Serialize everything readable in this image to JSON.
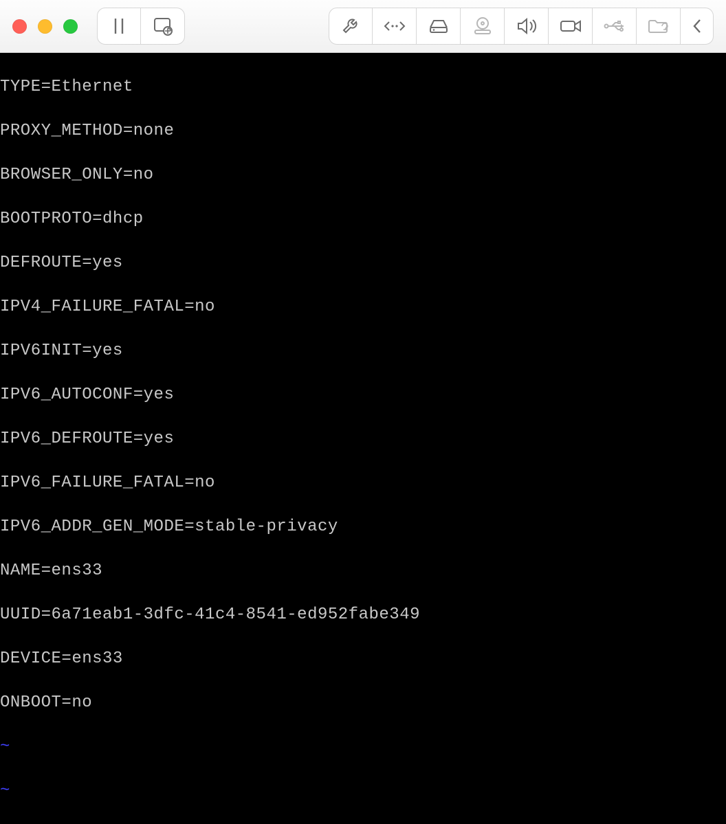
{
  "window": {
    "traffic_lights": [
      "close",
      "minimize",
      "zoom"
    ]
  },
  "toolbar": {
    "left_group": [
      {
        "name": "pause-button",
        "icon": "pause-icon"
      },
      {
        "name": "snapshot-button",
        "icon": "snapshot-icon"
      }
    ],
    "right_group": [
      {
        "name": "settings-button",
        "icon": "wrench-icon"
      },
      {
        "name": "fit-button",
        "icon": "resize-icon"
      },
      {
        "name": "disk-button",
        "icon": "hdd-icon"
      },
      {
        "name": "optical-button",
        "icon": "cd-icon"
      },
      {
        "name": "sound-button",
        "icon": "speaker-icon"
      },
      {
        "name": "camera-button",
        "icon": "camera-icon"
      },
      {
        "name": "usb-button",
        "icon": "usb-icon"
      },
      {
        "name": "share-button",
        "icon": "share-folder-icon"
      },
      {
        "name": "back-button",
        "icon": "chevron-left-icon"
      }
    ]
  },
  "terminal": {
    "lines": [
      "TYPE=Ethernet",
      "PROXY_METHOD=none",
      "BROWSER_ONLY=no",
      "BOOTPROTO=dhcp",
      "DEFROUTE=yes",
      "IPV4_FAILURE_FATAL=no",
      "IPV6INIT=yes",
      "IPV6_AUTOCONF=yes",
      "IPV6_DEFROUTE=yes",
      "IPV6_FAILURE_FATAL=no",
      "IPV6_ADDR_GEN_MODE=stable-privacy",
      "NAME=ens33",
      "UUID=6a71eab1-3dfc-41c4-8541-ed952fabe349",
      "DEVICE=ens33",
      "ONBOOT=no"
    ],
    "tilde": "~",
    "tilde_count": 2
  }
}
